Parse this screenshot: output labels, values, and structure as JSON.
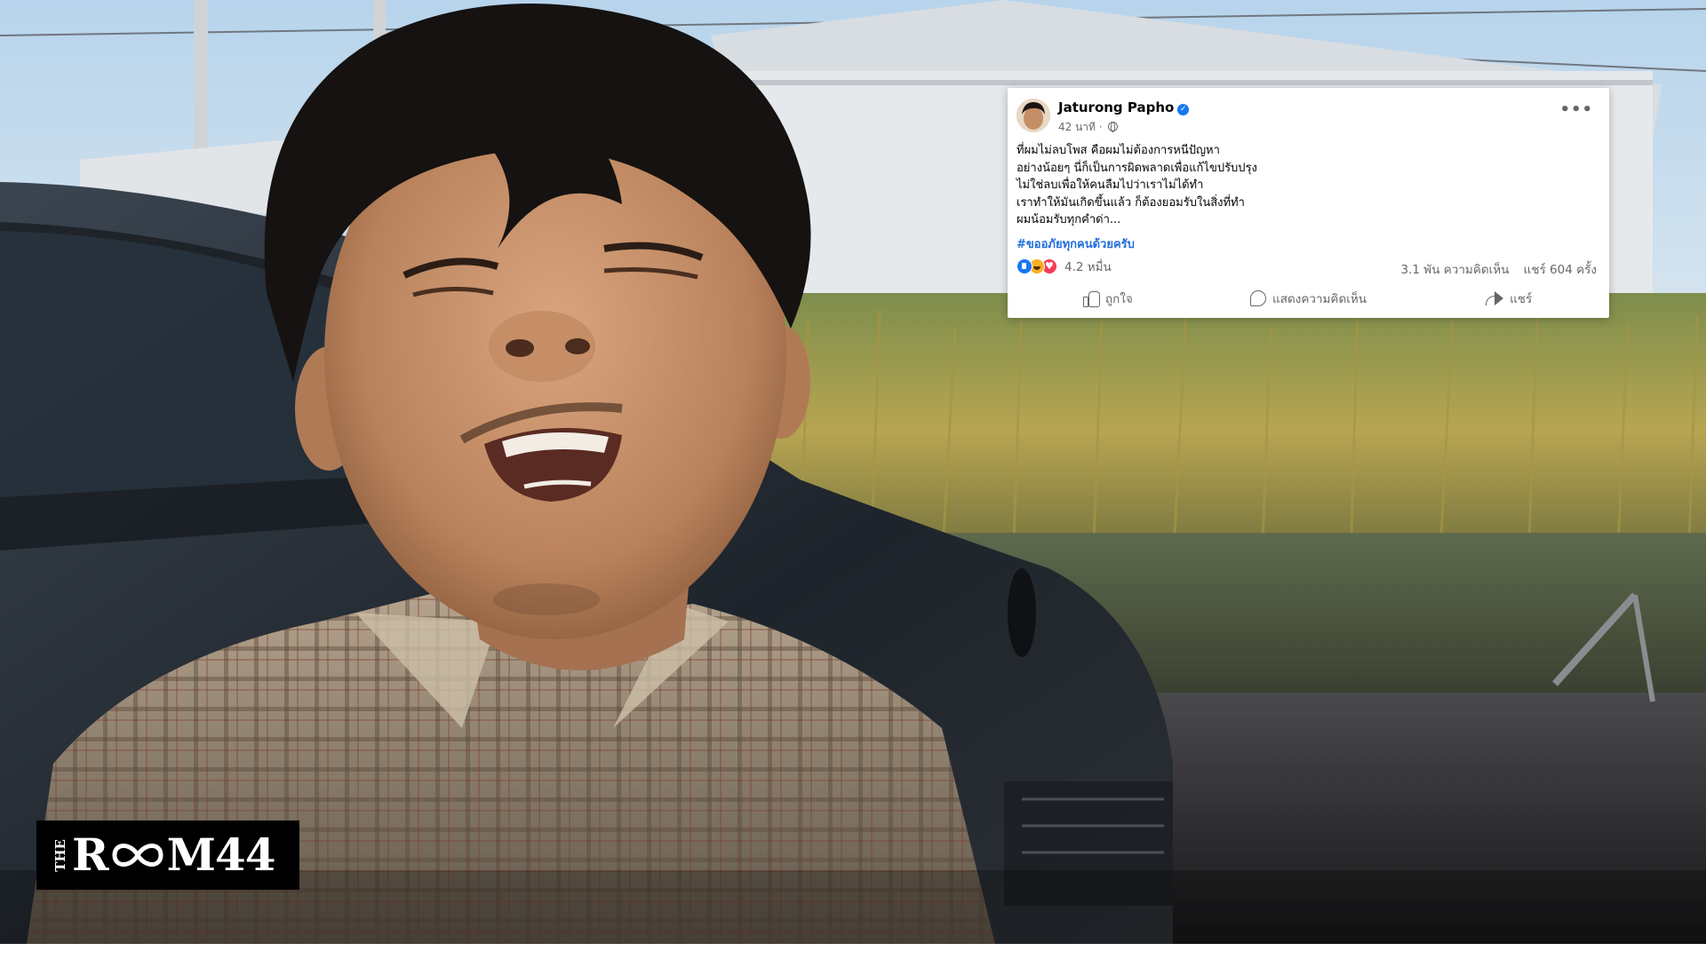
{
  "post": {
    "author": "Jaturong Papho",
    "verified": true,
    "time": "42 นาที ·",
    "more_label": "•••",
    "body_lines": [
      "ที่ผมไม่ลบโพส คือผมไม่ต้องการหนีปัญหา",
      "อย่างน้อยๆ นี่ก็เป็นการผิดพลาดเพื่อแก้ไขปรับปรุง",
      "ไม่ใช่ลบเพื่อให้คนลืมไปว่าเราไม่ได้ทำ",
      "เราทำให้มันเกิดขึ้นแล้ว ก็ต้องยอมรับในสิ่งที่ทำ",
      "ผมน้อมรับทุกคำด่า..."
    ],
    "hashtag": "#ขออภัยทุกคนด้วยครับ",
    "reactions": [
      "like",
      "haha",
      "love"
    ],
    "reaction_count": "4.2 หมื่น",
    "comments": "3.1 พัน ความคิดเห็น",
    "shares": "แชร์ 604 ครั้ง",
    "actions": {
      "like": "ถูกใจ",
      "comment": "แสดงความคิดเห็น",
      "share": "แชร์"
    }
  },
  "logo": {
    "the": "THE",
    "left": "R",
    "right": "M44"
  },
  "colors": {
    "facebook_blue": "#1877f2",
    "hashtag": "#216fdb",
    "muted_text": "#65676b",
    "logo_bg": "#000000"
  },
  "icons": [
    "verified-badge-icon",
    "globe-icon",
    "more-options-icon",
    "like-reaction-icon",
    "haha-reaction-icon",
    "love-reaction-icon",
    "thumb-up-icon",
    "comment-bubble-icon",
    "share-arrow-icon",
    "infinity-icon"
  ]
}
